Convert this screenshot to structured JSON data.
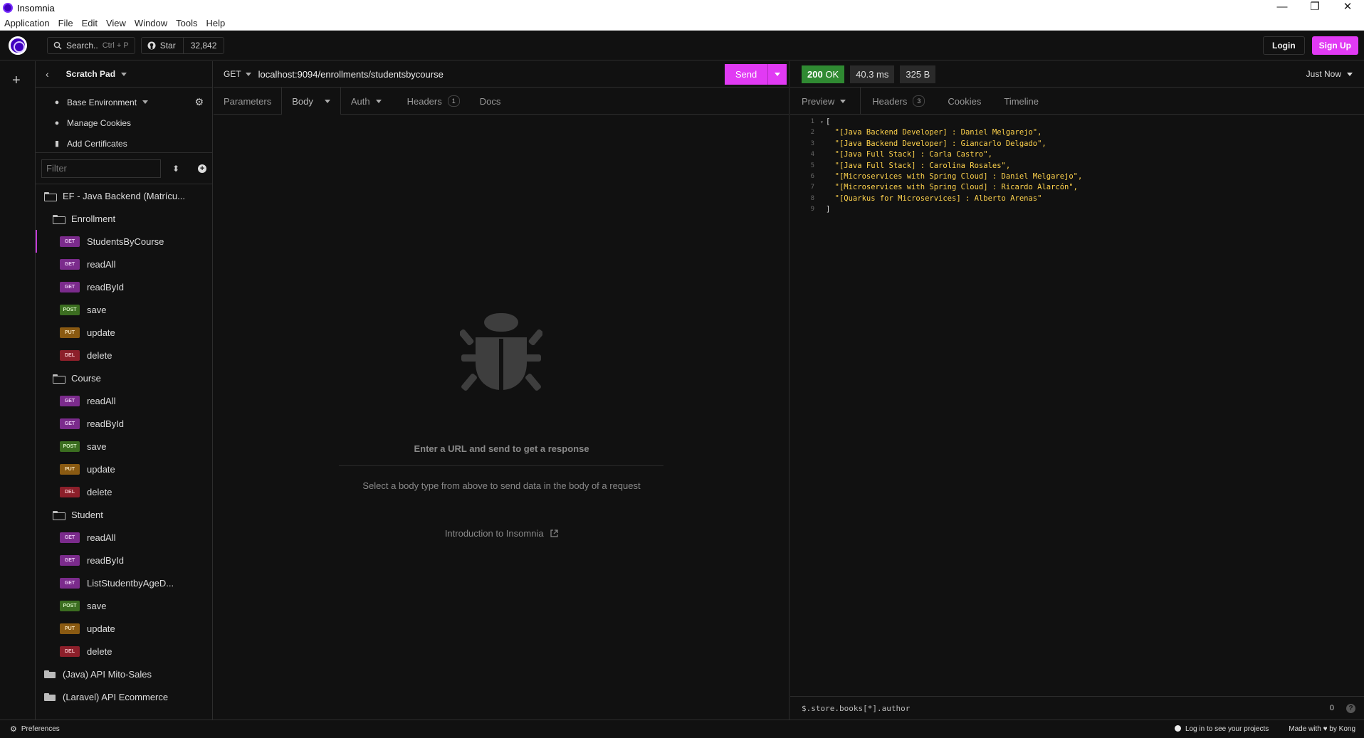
{
  "window": {
    "title": "Insomnia",
    "controls": {
      "minimize": "—",
      "restore": "❐",
      "close": "✕"
    }
  },
  "menu": [
    "Application",
    "File",
    "Edit",
    "View",
    "Window",
    "Tools",
    "Help"
  ],
  "header": {
    "search_label": "Search..",
    "search_shortcut": "Ctrl + P",
    "star_label": "Star",
    "star_count": "32,842",
    "login_label": "Login",
    "signup_label": "Sign Up"
  },
  "sidebar": {
    "project_name": "Scratch Pad",
    "env_label": "Base Environment",
    "cookies_label": "Manage Cookies",
    "certs_label": "Add Certificates",
    "filter_placeholder": "Filter",
    "tree": [
      {
        "type": "folder",
        "open": true,
        "level": 0,
        "label": "EF - Java Backend (Matrícu..."
      },
      {
        "type": "folder",
        "open": true,
        "level": 1,
        "label": "Enrollment"
      },
      {
        "type": "request",
        "level": 2,
        "method": "GET",
        "label": "StudentsByCourse",
        "active": true
      },
      {
        "type": "request",
        "level": 2,
        "method": "GET",
        "label": "readAll"
      },
      {
        "type": "request",
        "level": 2,
        "method": "GET",
        "label": "readById"
      },
      {
        "type": "request",
        "level": 2,
        "method": "POST",
        "label": "save"
      },
      {
        "type": "request",
        "level": 2,
        "method": "PUT",
        "label": "update"
      },
      {
        "type": "request",
        "level": 2,
        "method": "DEL",
        "label": "delete"
      },
      {
        "type": "folder",
        "open": true,
        "level": 1,
        "label": "Course"
      },
      {
        "type": "request",
        "level": 2,
        "method": "GET",
        "label": "readAll"
      },
      {
        "type": "request",
        "level": 2,
        "method": "GET",
        "label": "readById"
      },
      {
        "type": "request",
        "level": 2,
        "method": "POST",
        "label": "save"
      },
      {
        "type": "request",
        "level": 2,
        "method": "PUT",
        "label": "update"
      },
      {
        "type": "request",
        "level": 2,
        "method": "DEL",
        "label": "delete"
      },
      {
        "type": "folder",
        "open": true,
        "level": 1,
        "label": "Student"
      },
      {
        "type": "request",
        "level": 2,
        "method": "GET",
        "label": "readAll"
      },
      {
        "type": "request",
        "level": 2,
        "method": "GET",
        "label": "readById"
      },
      {
        "type": "request",
        "level": 2,
        "method": "GET",
        "label": "ListStudentbyAgeD..."
      },
      {
        "type": "request",
        "level": 2,
        "method": "POST",
        "label": "save"
      },
      {
        "type": "request",
        "level": 2,
        "method": "PUT",
        "label": "update"
      },
      {
        "type": "request",
        "level": 2,
        "method": "DEL",
        "label": "delete"
      },
      {
        "type": "folder",
        "open": false,
        "level": 0,
        "label": "(Java) API Mito-Sales"
      },
      {
        "type": "folder",
        "open": false,
        "level": 0,
        "label": "(Laravel) API Ecommerce"
      }
    ]
  },
  "request": {
    "method": "GET",
    "url": "localhost:9094/enrollments/studentsbycourse",
    "send_label": "Send",
    "tabs": {
      "parameters": "Parameters",
      "body": "Body",
      "auth": "Auth",
      "headers": "Headers",
      "headers_count": "1",
      "docs": "Docs"
    },
    "empty_title": "Enter a URL and send to get a response",
    "empty_subtitle": "Select a body type from above to send data in the body of a request",
    "intro_link": "Introduction to Insomnia"
  },
  "response": {
    "status_code": "200",
    "status_text": "OK",
    "time": "40.3 ms",
    "size": "325 B",
    "timestamp": "Just Now",
    "tabs": {
      "preview": "Preview",
      "headers": "Headers",
      "headers_count": "3",
      "cookies": "Cookies",
      "timeline": "Timeline"
    },
    "body_lines": [
      "[",
      "  \"[Java Backend Developer] : Daniel Melgarejo\",",
      "  \"[Java Backend Developer] : Giancarlo Delgado\",",
      "  \"[Java Full Stack] : Carla Castro\",",
      "  \"[Java Full Stack] : Carolina Rosales\",",
      "  \"[Microservices with Spring Cloud] : Daniel Melgarejo\",",
      "  \"[Microservices with Spring Cloud] : Ricardo Alarcón\",",
      "  \"[Quarkus for Microservices] : Alberto Arenas\"",
      "]"
    ],
    "filter_query": "$.store.books[*].author",
    "filter_count": "0"
  },
  "footer": {
    "preferences": "Preferences",
    "login_projects": "Log in to see your projects",
    "made_with": "Made with ♥ by Kong"
  }
}
